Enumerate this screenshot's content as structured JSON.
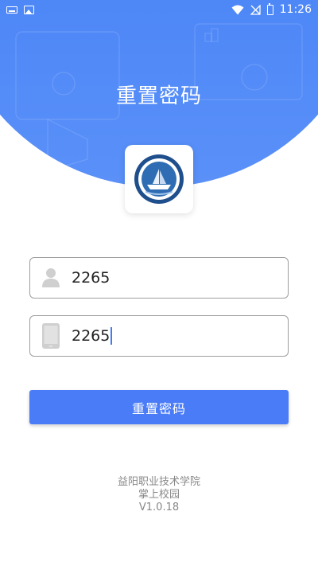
{
  "status_bar": {
    "time": "11:26",
    "icons_left": [
      "keyboard-icon",
      "image-icon"
    ],
    "icons_right": [
      "wifi-icon",
      "no-signal-icon",
      "battery-icon"
    ]
  },
  "header": {
    "title": "重置密码",
    "background_color": "#4a85f7"
  },
  "logo": {
    "name": "school-logo"
  },
  "form": {
    "account": {
      "value": "2265",
      "icon": "user-icon"
    },
    "phone": {
      "value": "2265",
      "icon": "phone-icon",
      "focused": true
    },
    "submit_label": "重置密码",
    "accent_color": "#4a7cf7"
  },
  "footer": {
    "school_name": "益阳职业技术学院",
    "app_name": "掌上校园",
    "version": "V1.0.18"
  }
}
